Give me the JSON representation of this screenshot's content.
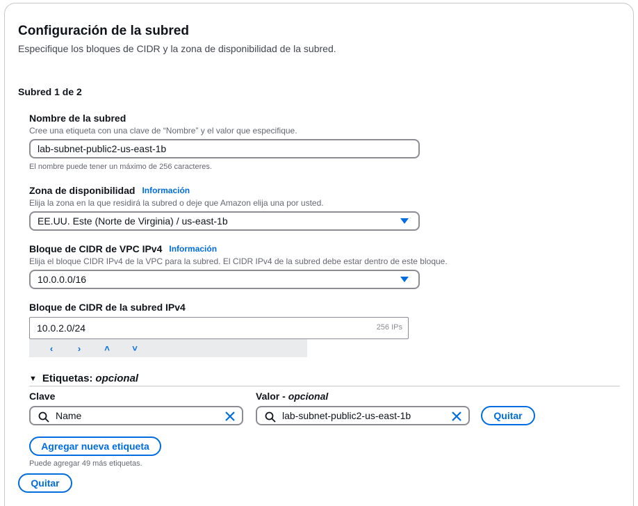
{
  "section": {
    "title": "Configuración de la subred",
    "description": "Especifique los bloques de CIDR y la zona de disponibilidad de la subred."
  },
  "subnet_header": "Subred 1 de 2",
  "name_field": {
    "label": "Nombre de la subred",
    "description": "Cree una etiqueta con una clave de “Nombre” y el valor que especifique.",
    "value": "lab-subnet-public2-us-east-1b",
    "constraint": "El nombre puede tener un máximo de 256 caracteres."
  },
  "az_field": {
    "label": "Zona de disponibilidad",
    "info": "Información",
    "description": "Elija la zona en la que residirá la subred o deje que Amazon elija una por usted.",
    "value": "EE.UU. Este (Norte de Virginia) / us-east-1b"
  },
  "vpc_cidr_field": {
    "label": "Bloque de CIDR de VPC IPv4",
    "info": "Información",
    "description": "Elija el bloque CIDR IPv4 de la VPC para la subred. El CIDR IPv4 de la subred debe estar dentro de este bloque.",
    "value": "10.0.0.0/16"
  },
  "subnet_cidr_field": {
    "label": "Bloque de CIDR de la subred IPv4",
    "value": "10.0.2.0/24",
    "hint": "256 IPs",
    "stepper": [
      "‹",
      "›",
      "˄",
      "˅"
    ]
  },
  "tags": {
    "title": "Etiquetas:",
    "optional": "opcional",
    "key_label": "Clave",
    "value_label": "Valor -",
    "value_optional": "opcional",
    "key": "Name",
    "value": "lab-subnet-public2-us-east-1b",
    "remove_label": "Quitar",
    "add_label": "Agregar nueva etiqueta",
    "remaining": "Puede agregar 49 más etiquetas."
  },
  "remove_subnet_label": "Quitar",
  "colors": {
    "accent": "#006ce0",
    "border": "#8c8c94",
    "text": "#0f141a",
    "muted": "#656871"
  }
}
